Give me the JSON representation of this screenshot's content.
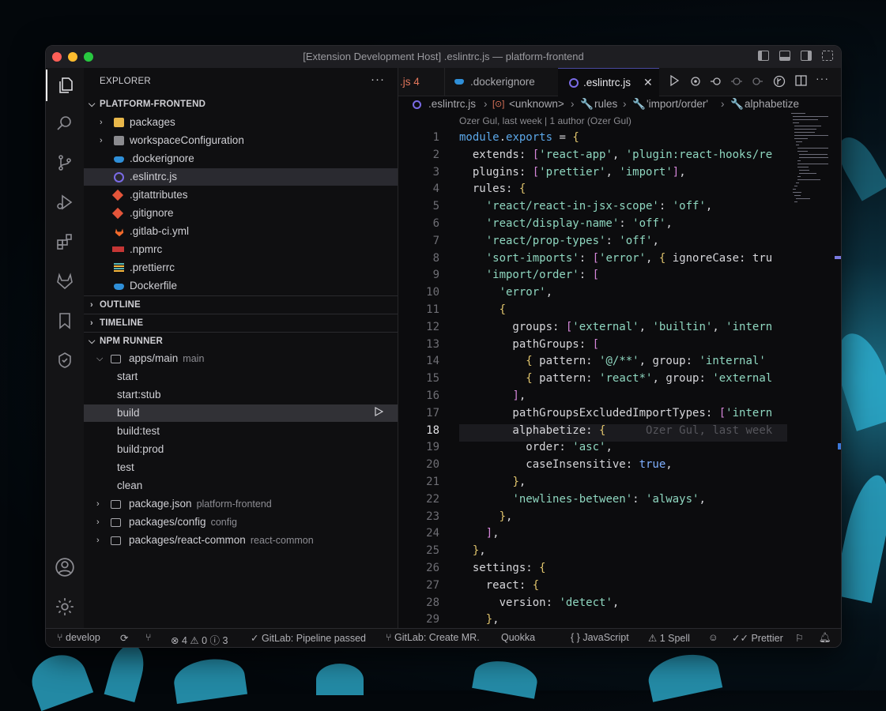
{
  "window": {
    "title": "[Extension Development Host] .eslintrc.js — platform-frontend"
  },
  "explorer": {
    "header": "EXPLORER",
    "more": "···",
    "project": "PLATFORM-FRONTEND",
    "items": [
      {
        "label": "packages",
        "icon": "folder-icon"
      },
      {
        "label": "workspaceConfiguration",
        "icon": "folder-icon"
      },
      {
        "label": ".dockerignore",
        "icon": "docker-icon"
      },
      {
        "label": ".eslintrc.js",
        "icon": "eslint-icon"
      },
      {
        "label": ".gitattributes",
        "icon": "git-icon"
      },
      {
        "label": ".gitignore",
        "icon": "git-icon"
      },
      {
        "label": ".gitlab-ci.yml",
        "icon": "gitlab-icon"
      },
      {
        "label": ".npmrc",
        "icon": "npm-icon"
      },
      {
        "label": ".prettierrc",
        "icon": "prettier-icon"
      },
      {
        "label": "Dockerfile",
        "icon": "docker-icon"
      }
    ],
    "sections": {
      "outline": "OUTLINE",
      "timeline": "TIMELINE",
      "npm": "NPM RUNNER"
    },
    "npm": {
      "group": "apps/main",
      "group_desc": "main",
      "scripts": [
        "start",
        "start:stub",
        "build",
        "build:test",
        "build:prod",
        "test",
        "clean"
      ],
      "others": [
        {
          "label": "package.json",
          "desc": "platform-frontend"
        },
        {
          "label": "packages/config",
          "desc": "config"
        },
        {
          "label": "packages/react-common",
          "desc": "react-common"
        }
      ]
    }
  },
  "tabs": [
    {
      "label": ".js 4"
    },
    {
      "label": ".dockerignore"
    },
    {
      "label": ".eslintrc.js",
      "active": true
    }
  ],
  "tab_close": "✕",
  "breadcrumbs": [
    ".eslintrc.js",
    "<unknown>",
    "rules",
    "'import/order'",
    "alphabetize"
  ],
  "blame": "Ozer Gul, last week | 1 author (Ozer Gul)",
  "current_line": 18,
  "code_lines": [
    "module.exports = {",
    "  extends: ['react-app', 'plugin:react-hooks/re",
    "  plugins: ['prettier', 'import'],",
    "  rules: {",
    "    'react/react-in-jsx-scope': 'off',",
    "    'react/display-name': 'off',",
    "    'react/prop-types': 'off',",
    "    'sort-imports': ['error', { ignoreCase: tru",
    "    'import/order': [",
    "      'error',",
    "      {",
    "        groups: ['external', 'builtin', 'intern",
    "        pathGroups: [",
    "          { pattern: '@/**', group: 'internal'",
    "          { pattern: 'react*', group: 'external",
    "        ],",
    "        pathGroupsExcludedImportTypes: ['intern",
    "        alphabetize: {",
    "          order: 'asc',",
    "          caseInsensitive: true,",
    "        },",
    "        'newlines-between': 'always',",
    "      },",
    "    ],",
    "  },",
    "  settings: {",
    "    react: {",
    "      version: 'detect',",
    "    },"
  ],
  "ghost_blame": "Ozer Gul, last week",
  "status": {
    "branch": "develop",
    "errors": "4",
    "warnings": "0",
    "infos": "3",
    "pipeline": "GitLab: Pipeline passed",
    "create_mr": "GitLab: Create MR.",
    "quokka": "Quokka",
    "language": "JavaScript",
    "spell": "1 Spell",
    "prettier": "Prettier"
  },
  "colors": {
    "accent": "#4a4aa0",
    "string": "#8fd7c0",
    "keyword": "#5ba7e8"
  }
}
